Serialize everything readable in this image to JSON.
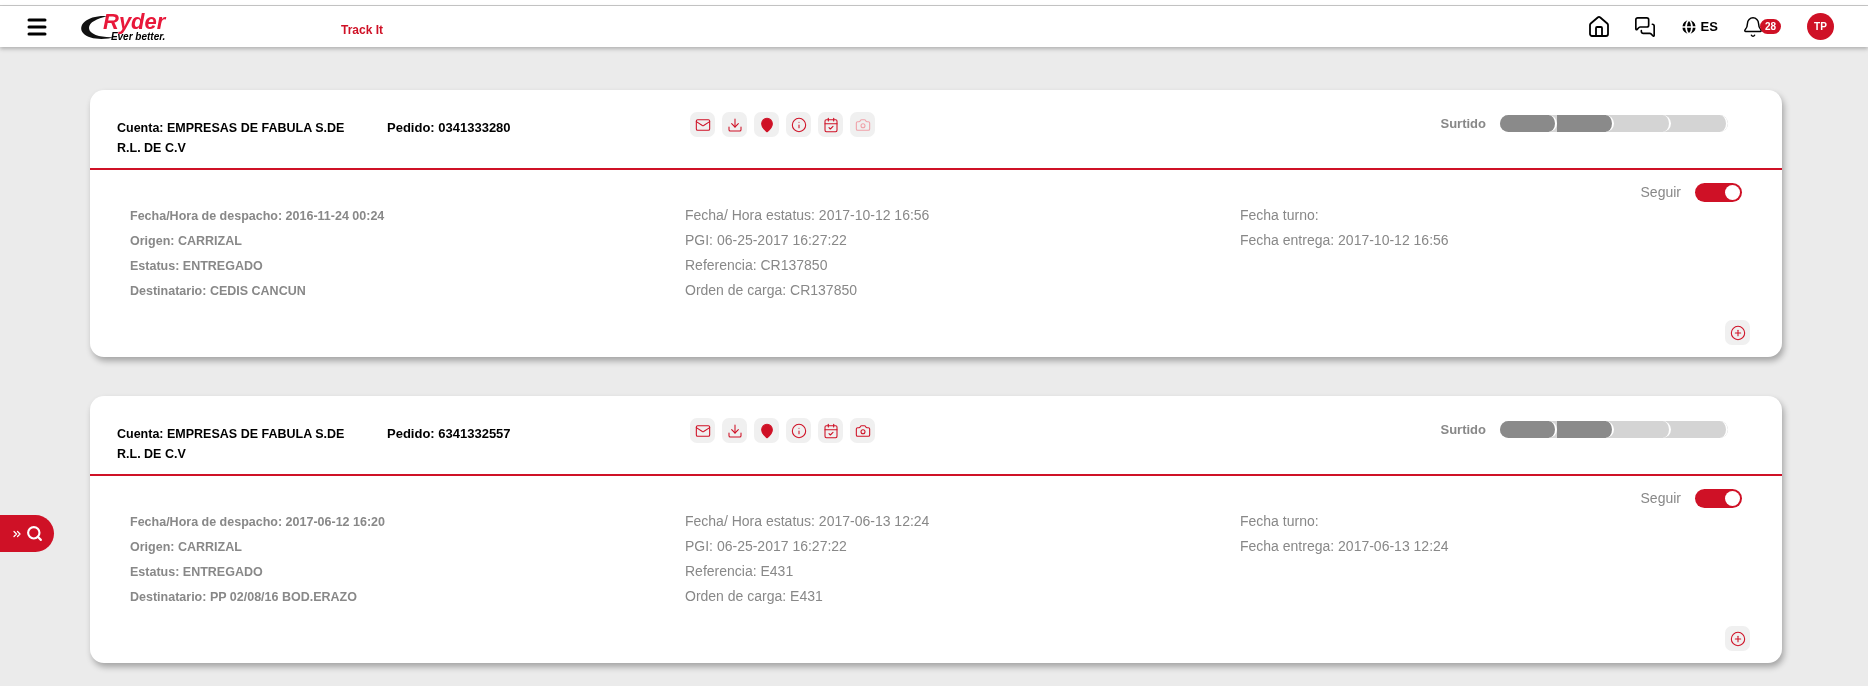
{
  "header": {
    "logo": {
      "name": "Ryder",
      "tagline": "Ever better."
    },
    "app_title": "Track It",
    "language": "ES",
    "notifications": "28",
    "user_initials": "TP"
  },
  "orders": [
    {
      "account": "Cuenta: EMPRESAS DE FABULA S.DE R.L. DE C.V",
      "order": "Pedido: 0341333280",
      "actions": [
        {
          "kind": "mail",
          "disabled": false
        },
        {
          "kind": "download",
          "disabled": false
        },
        {
          "kind": "pin",
          "disabled": false
        },
        {
          "kind": "info",
          "disabled": false
        },
        {
          "kind": "calendar",
          "disabled": false
        },
        {
          "kind": "camera",
          "disabled": true
        }
      ],
      "stage": "Surtido",
      "steps": [
        {
          "complete": true
        },
        {
          "complete": true
        },
        {
          "complete": false
        },
        {
          "complete": false
        }
      ],
      "follow": {
        "label": "Seguir",
        "on": true
      },
      "left": [
        "Fecha/Hora de despacho: 2016-11-24 00:24",
        "Origen: CARRIZAL",
        "Estatus: ENTREGADO",
        "Destinatario: CEDIS CANCUN"
      ],
      "middle": [
        "Fecha/ Hora estatus: 2017-10-12 16:56",
        "PGI: 06-25-2017 16:27:22",
        "Referencia: CR137850",
        "Orden de carga: CR137850"
      ],
      "right": [
        "Fecha turno:",
        "Fecha entrega: 2017-10-12 16:56"
      ]
    },
    {
      "account": "Cuenta: EMPRESAS DE FABULA S.DE R.L. DE C.V",
      "order": "Pedido: 6341332557",
      "actions": [
        {
          "kind": "mail",
          "disabled": false
        },
        {
          "kind": "download",
          "disabled": false
        },
        {
          "kind": "pin",
          "disabled": false
        },
        {
          "kind": "info",
          "disabled": false
        },
        {
          "kind": "calendar",
          "disabled": false
        },
        {
          "kind": "camera",
          "disabled": false
        }
      ],
      "stage": "Surtido",
      "steps": [
        {
          "complete": true
        },
        {
          "complete": true
        },
        {
          "complete": false
        },
        {
          "complete": false
        }
      ],
      "follow": {
        "label": "Seguir",
        "on": true
      },
      "left": [
        "Fecha/Hora de despacho: 2017-06-12 16:20",
        "Origen: CARRIZAL",
        "Estatus: ENTREGADO",
        "Destinatario: PP 02/08/16 BOD.ERAZO"
      ],
      "middle": [
        "Fecha/ Hora estatus: 2017-06-13 12:24",
        "PGI: 06-25-2017 16:27:22",
        "Referencia: E431",
        "Orden de carga: E431"
      ],
      "right": [
        "Fecha turno:",
        "Fecha entrega: 2017-06-13 12:24"
      ]
    }
  ]
}
